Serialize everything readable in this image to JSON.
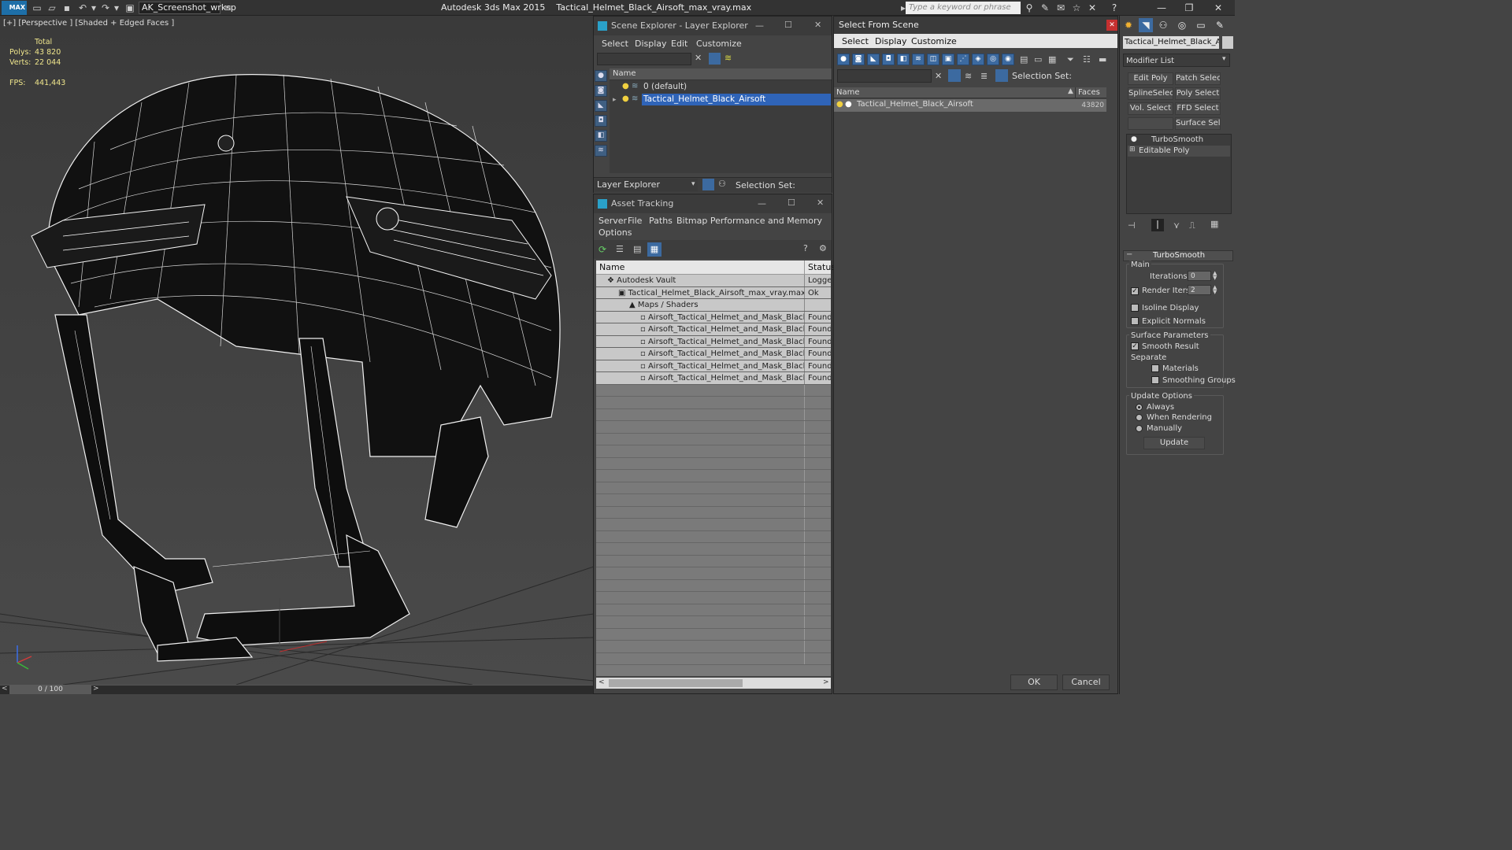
{
  "titlebar": {
    "logo": "MAX",
    "workspace": "AK_Screenshot_wrksp",
    "app_name": "Autodesk 3ds Max  2015",
    "file_name": "Tactical_Helmet_Black_Airsoft_max_vray.max",
    "search_placeholder": "Type a keyword or phrase"
  },
  "viewport": {
    "label": "[+] [Perspective ] [Shaded + Edged Faces ]",
    "stats": {
      "total_label": "Total",
      "polys_label": "Polys:",
      "polys_value": "43 820",
      "verts_label": "Verts:",
      "verts_value": "22 044",
      "fps_label": "FPS:",
      "fps_value": "441,443"
    },
    "timeline": "0 / 100"
  },
  "scene_explorer": {
    "title": "Scene Explorer - Layer Explorer",
    "menu": [
      "Select",
      "Display",
      "Edit",
      "Customize"
    ],
    "column_name": "Name",
    "rows": [
      "0 (default)",
      "Tactical_Helmet_Black_Airsoft"
    ],
    "footer_dropdown": "Layer Explorer",
    "footer_selection": "Selection Set:"
  },
  "asset_tracking": {
    "title": "Asset Tracking",
    "menu": [
      "Server",
      "File",
      "Paths",
      "Bitmap Performance and Memory",
      "Options"
    ],
    "col_name": "Name",
    "col_status": "Status",
    "rows": [
      {
        "name": "Autodesk Vault",
        "status": "Logged"
      },
      {
        "name": "Tactical_Helmet_Black_Airsoft_max_vray.max",
        "status": "Ok"
      },
      {
        "name": "Maps / Shaders",
        "status": ""
      },
      {
        "name": "Airsoft_Tactical_Helmet_and_Mask_Black_...",
        "status": "Found"
      },
      {
        "name": "Airsoft_Tactical_Helmet_and_Mask_Black_...",
        "status": "Found"
      },
      {
        "name": "Airsoft_Tactical_Helmet_and_Mask_Black_...",
        "status": "Found"
      },
      {
        "name": "Airsoft_Tactical_Helmet_and_Mask_Black_...",
        "status": "Found"
      },
      {
        "name": "Airsoft_Tactical_Helmet_and_Mask_Black_...",
        "status": "Found"
      },
      {
        "name": "Airsoft_Tactical_Helmet_and_Mask_Black_...",
        "status": "Found"
      }
    ]
  },
  "select_from_scene": {
    "title": "Select From Scene",
    "menu": [
      "Select",
      "Display",
      "Customize"
    ],
    "selection_set": "Selection Set:",
    "col_name": "Name",
    "col_faces": "Faces",
    "row_name": "Tactical_Helmet_Black_Airsoft",
    "row_faces": "43820",
    "ok": "OK",
    "cancel": "Cancel"
  },
  "command_panel": {
    "object_name": "Tactical_Helmet_Black_Airsof",
    "modifier_list": "Modifier List",
    "buttons": [
      "Edit Poly",
      "Patch Select",
      "SplineSelect",
      "Poly Select",
      "Vol. Select",
      "FFD Select",
      "Surface Select"
    ],
    "stack": [
      "TurboSmooth",
      "Editable Poly"
    ],
    "rollout_title": "TurboSmooth",
    "main_label": "Main",
    "iterations_label": "Iterations:",
    "iterations_value": "0",
    "render_iters_label": "Render Iters:",
    "render_iters_value": "2",
    "isoline": "Isoline Display",
    "explicit_normals": "Explicit Normals",
    "surface_params": "Surface Parameters",
    "smooth_result": "Smooth Result",
    "separate": "Separate",
    "materials": "Materials",
    "smoothing_groups": "Smoothing Groups",
    "update_options": "Update Options",
    "always": "Always",
    "when_rendering": "When Rendering",
    "manually": "Manually",
    "update": "Update"
  }
}
